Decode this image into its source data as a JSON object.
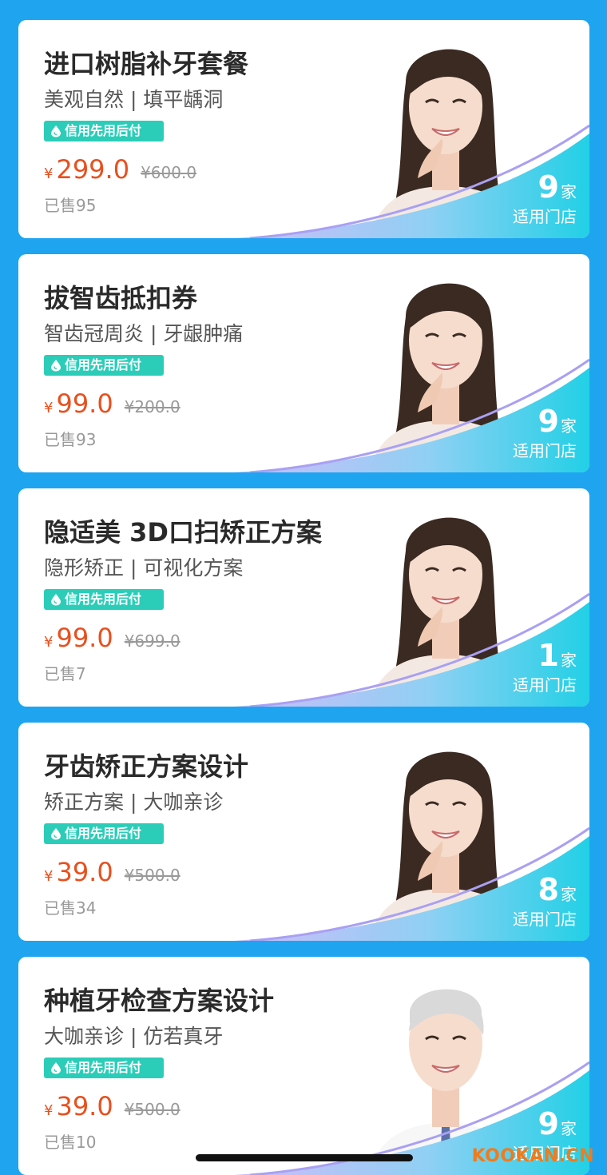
{
  "cards": [
    {
      "title": "进口树脂补牙套餐",
      "subtitle": "美观自然 | 填平龋洞",
      "badge": "信用先用后付",
      "currency": "¥",
      "price": "299.0",
      "original_price": "¥600.0",
      "sold": "已售95",
      "store_count": "9",
      "store_unit": "家",
      "store_label": "适用门店",
      "portrait": "woman-smiling-icon"
    },
    {
      "title": "拔智齿抵扣券",
      "subtitle": "智齿冠周炎 | 牙龈肿痛",
      "badge": "信用先用后付",
      "currency": "¥",
      "price": "99.0",
      "original_price": "¥200.0",
      "sold": "已售93",
      "store_count": "9",
      "store_unit": "家",
      "store_label": "适用门店",
      "portrait": "woman-smiling-icon"
    },
    {
      "title": "隐适美 3D口扫矫正方案",
      "subtitle": "隐形矫正 | 可视化方案",
      "badge": "信用先用后付",
      "currency": "¥",
      "price": "99.0",
      "original_price": "¥699.0",
      "sold": "已售7",
      "store_count": "1",
      "store_unit": "家",
      "store_label": "适用门店",
      "portrait": "woman-smiling-icon"
    },
    {
      "title": "牙齿矫正方案设计",
      "subtitle": "矫正方案 | 大咖亲诊",
      "badge": "信用先用后付",
      "currency": "¥",
      "price": "39.0",
      "original_price": "¥500.0",
      "sold": "已售34",
      "store_count": "8",
      "store_unit": "家",
      "store_label": "适用门店",
      "portrait": "woman-smiling-icon"
    },
    {
      "title": "种植牙检查方案设计",
      "subtitle": "大咖亲诊 | 仿若真牙",
      "badge": "信用先用后付",
      "currency": "¥",
      "price": "39.0",
      "original_price": "¥500.0",
      "sold": "已售10",
      "store_count": "9",
      "store_unit": "家",
      "store_label": "适用门店",
      "portrait": "doctor-icon"
    }
  ],
  "watermark": "KOOKAN.CN",
  "colors": {
    "background": "#1fa4f0",
    "price": "#e8501e",
    "badge": "#2ccdb8",
    "wave_start": "#b9a6f5",
    "wave_end": "#2bd3e8"
  }
}
